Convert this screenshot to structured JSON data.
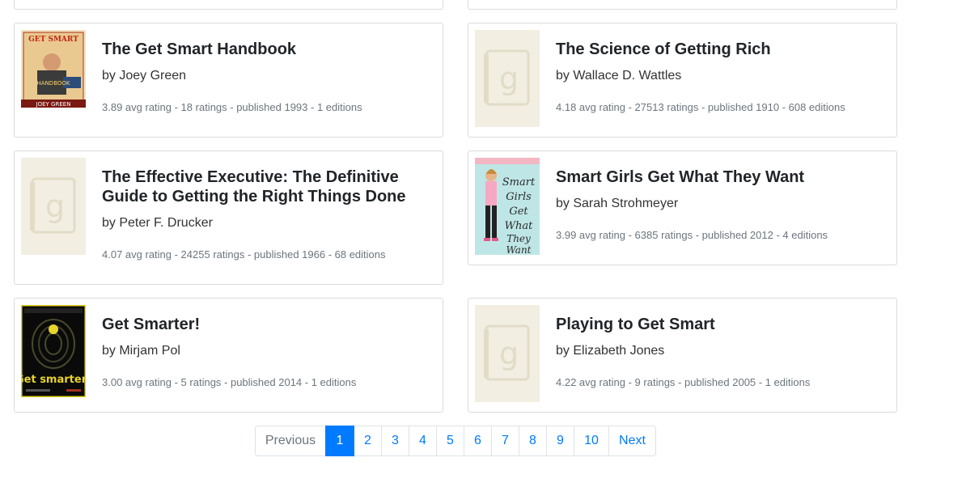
{
  "books": [
    {
      "title": "The Get Smart Handbook",
      "author": "by Joey Green",
      "meta": "3.89 avg rating - 18 ratings - published 1993 - 1 editions",
      "cover_icon": "get-smart-handbook-cover"
    },
    {
      "title": "The Science of Getting Rich",
      "author": "by Wallace D. Wattles",
      "meta": "4.18 avg rating - 27513 ratings - published 1910 - 608 editions",
      "cover_icon": "goodreads-placeholder-icon"
    },
    {
      "title": "The Effective Executive: The Definitive Guide to Getting the Right Things Done",
      "author": "by Peter F. Drucker",
      "meta": "4.07 avg rating - 24255 ratings - published 1966 - 68 editions",
      "cover_icon": "goodreads-placeholder-icon"
    },
    {
      "title": "Smart Girls Get What They Want",
      "author": "by Sarah Strohmeyer",
      "meta": "3.99 avg rating - 6385 ratings - published 2012 - 4 editions",
      "cover_icon": "smart-girls-cover"
    },
    {
      "title": "Get Smarter!",
      "author": "by Mirjam Pol",
      "meta": "3.00 avg rating - 5 ratings - published 2014 - 1 editions",
      "cover_icon": "get-smarter-cover"
    },
    {
      "title": "Playing to Get Smart",
      "author": "by Elizabeth Jones",
      "meta": "4.22 avg rating - 9 ratings - published 2005 - 1 editions",
      "cover_icon": "goodreads-placeholder-icon"
    }
  ],
  "pagination": {
    "previous": "Previous",
    "pages": [
      "1",
      "2",
      "3",
      "4",
      "5",
      "6",
      "7",
      "8",
      "9",
      "10"
    ],
    "active": "1",
    "next": "Next"
  },
  "colors": {
    "accent": "#007bff",
    "muted": "#6c757d",
    "border": "#dcdcdc",
    "placeholder_bg": "#f2eee2"
  }
}
